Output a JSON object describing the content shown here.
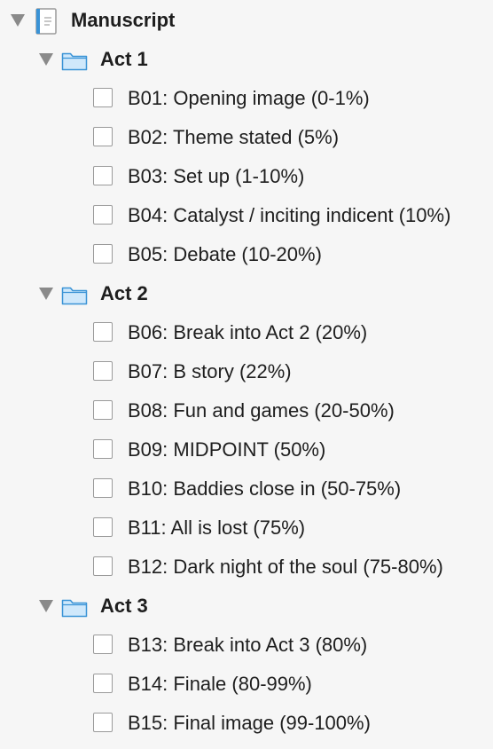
{
  "root": {
    "label": "Manuscript",
    "icon": "text-document-icon",
    "expanded": true
  },
  "acts": [
    {
      "label": "Act 1",
      "icon": "folder-icon",
      "expanded": true,
      "items": [
        "B01: Opening image (0-1%)",
        "B02: Theme stated (5%)",
        "B03: Set up (1-10%)",
        "B04: Catalyst / inciting indicent (10%)",
        "B05: Debate (10-20%)"
      ]
    },
    {
      "label": "Act 2",
      "icon": "folder-icon",
      "expanded": true,
      "items": [
        "B06: Break into Act 2 (20%)",
        "B07: B story (22%)",
        "B08: Fun and games (20-50%)",
        "B09: MIDPOINT (50%)",
        "B10: Baddies close in (50-75%)",
        "B11: All is lost (75%)",
        "B12: Dark night of the soul (75-80%)"
      ]
    },
    {
      "label": "Act 3",
      "icon": "folder-icon",
      "expanded": true,
      "items": [
        "B13: Break into Act 3 (80%)",
        "B14: Finale (80-99%)",
        "B15: Final image (99-100%)"
      ]
    }
  ],
  "colors": {
    "folder_fill": "#cfe8fb",
    "folder_stroke": "#3a93d6",
    "doc_accent": "#3a93d6",
    "disclosure": "#8a8a8a"
  }
}
